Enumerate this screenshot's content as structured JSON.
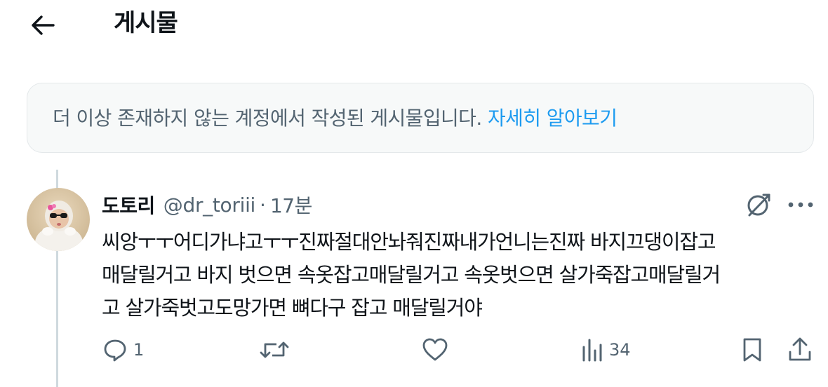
{
  "header": {
    "title": "게시물"
  },
  "notice": {
    "text": "더 이상 존재하지 않는 계정에서 작성된 게시물입니다. ",
    "link": "자세히 알아보기"
  },
  "tweet": {
    "display_name": "도토리",
    "handle": "@dr_toriii",
    "separator": "·",
    "time": "17분",
    "body_lines": [
      "씨앙ㅜㅜ어디가냐고ㅜㅜ진짜절대안놔줘진짜내가언니는진짜 바지끄댕이잡고",
      "매달릴거고 바지 벗으면 속옷잡고매달릴거고 속옷벗으면 살가죽잡고매달릴거",
      "고 살가죽벗고도망가면 뼈다구 잡고 매달릴거야"
    ],
    "actions": {
      "reply_count": "1",
      "retweet_count": "",
      "like_count": "",
      "views_count": "34"
    }
  },
  "icons": {
    "back": "arrow-left-icon",
    "grok": "grok-icon",
    "more": "more-horizontal-icon",
    "reply": "reply-icon",
    "retweet": "retweet-icon",
    "like": "heart-icon",
    "views": "views-chart-icon",
    "bookmark": "bookmark-icon",
    "share": "share-icon"
  },
  "colors": {
    "link": "#1d9bf0",
    "secondary_text": "#536471",
    "notice_bg": "#f7f9f9"
  }
}
